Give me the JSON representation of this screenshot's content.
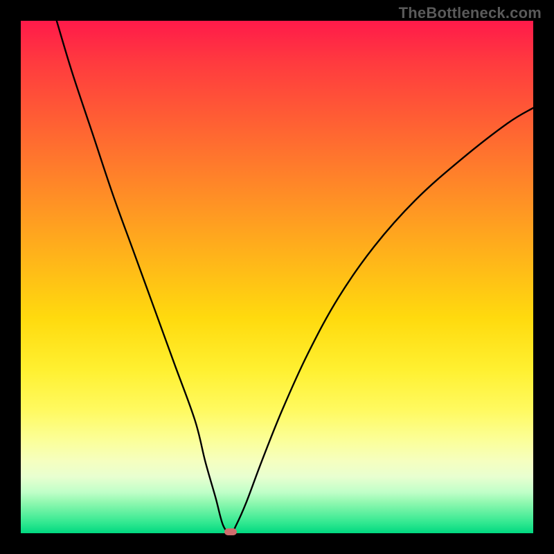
{
  "watermark": "TheBottleneck.com",
  "chart_data": {
    "type": "line",
    "title": "",
    "xlabel": "",
    "ylabel": "",
    "xlim": [
      0,
      100
    ],
    "ylim": [
      0,
      100
    ],
    "grid": false,
    "series": [
      {
        "name": "bottleneck-curve",
        "x": [
          7,
          10,
          14,
          18,
          22,
          26,
          30,
          34,
          36,
          38,
          39.5,
          41,
          42,
          44,
          47,
          51,
          56,
          62,
          69,
          77,
          86,
          95,
          100
        ],
        "values": [
          100,
          90,
          78,
          66,
          55,
          44,
          33,
          22,
          14,
          7,
          1.5,
          0,
          1.5,
          6,
          14,
          24,
          35,
          46,
          56,
          65,
          73,
          80,
          83
        ]
      }
    ],
    "annotations": [
      {
        "name": "minimum-marker",
        "x": 41,
        "y": 0,
        "color": "#cf6d6d"
      }
    ],
    "background": {
      "type": "vertical-gradient",
      "stops": [
        {
          "pos": 0.0,
          "color": "#ff1a4a"
        },
        {
          "pos": 0.5,
          "color": "#ffc814"
        },
        {
          "pos": 0.8,
          "color": "#fcff80"
        },
        {
          "pos": 1.0,
          "color": "#00d880"
        }
      ]
    }
  }
}
